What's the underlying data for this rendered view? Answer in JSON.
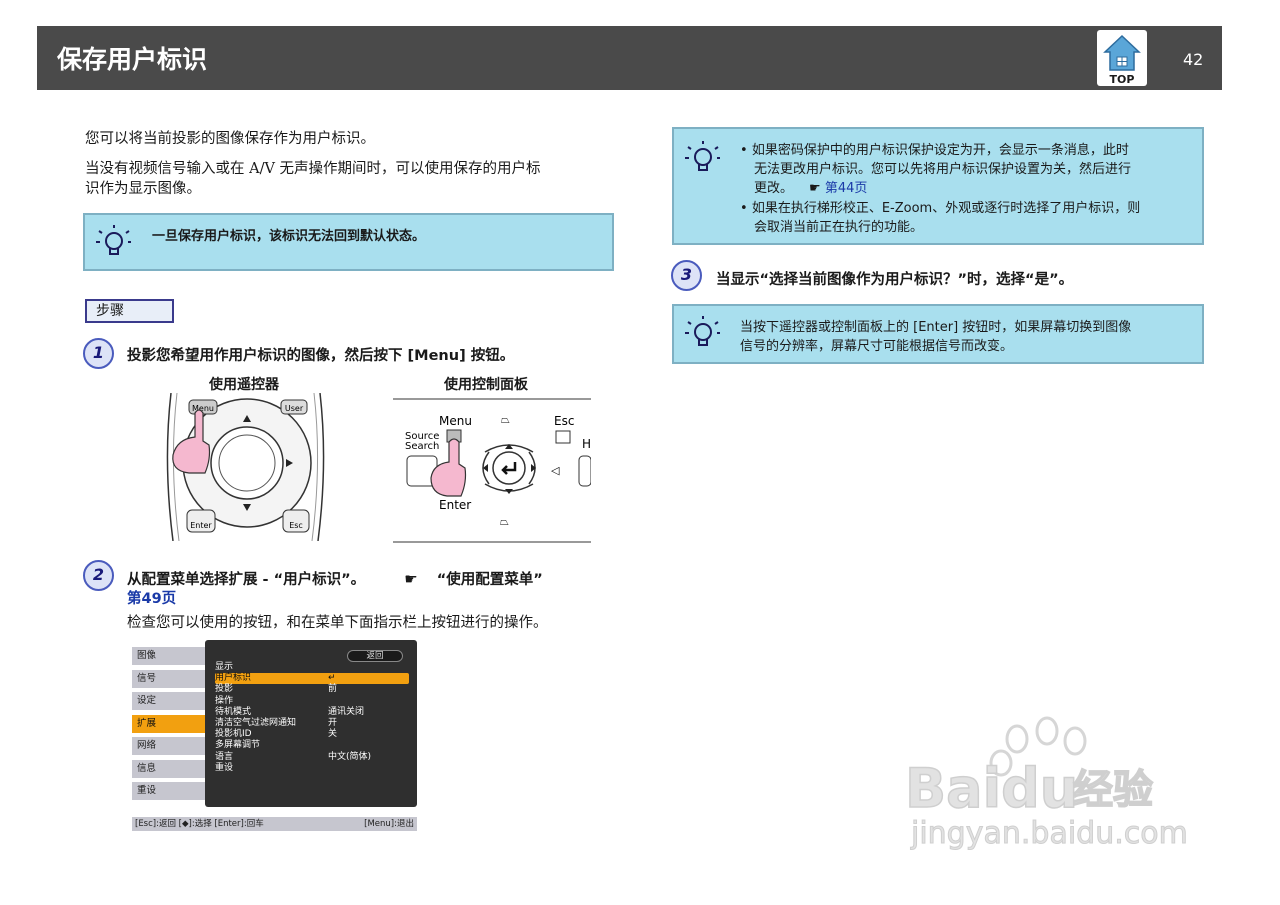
{
  "header": {
    "title": "保存用户标识",
    "top_label": "TOP",
    "page_number": "42"
  },
  "intro": {
    "line1": "您可以将当前投影的图像保存作为用户标识。",
    "line2a": "当没有视频信号输入或在 A/V 无声操作期间时，可以使用保存的用户标",
    "line2b": "识作为显示图像。"
  },
  "note1": {
    "text": "一旦保存用户标识，该标识无法回到默认状态。"
  },
  "steps_label": "步骤",
  "step1": {
    "number": "1",
    "title": "投影您希望用作用户标识的图像，然后按下 [Menu] 按钮。",
    "caption_remote": "使用遥控器",
    "caption_panel": "使用控制面板",
    "remote_labels": {
      "menu": "Menu",
      "user": "User",
      "enter": "Enter",
      "esc": "Esc"
    },
    "panel_labels": {
      "menu": "Menu",
      "esc": "Esc",
      "source": "Source",
      "search": "Search",
      "enter": "Enter",
      "h": "H"
    }
  },
  "step2": {
    "number": "2",
    "title_part1": "从配置菜单选择扩展 - “用户标识”。",
    "ref_icon": "pointing-hand-icon",
    "title_part2": "“使用配置菜单”",
    "page_ref": "第49页",
    "desc": "检查您可以使用的按钮，和在菜单下面指示栏上按钮进行的操作。"
  },
  "menu_screen": {
    "side_items": [
      "图像",
      "信号",
      "设定",
      "扩展",
      "网络",
      "信息",
      "重设"
    ],
    "active_side": "扩展",
    "back_label": "返回",
    "rows": [
      {
        "label": "显示",
        "value": ""
      },
      {
        "label": "用户标识",
        "value": "↵"
      },
      {
        "label": "投影",
        "value": "前"
      },
      {
        "label": "操作",
        "value": ""
      },
      {
        "label": "待机模式",
        "value": "通讯关闭"
      },
      {
        "label": "清洁空气过滤网通知",
        "value": "开"
      },
      {
        "label": "投影机ID",
        "value": "关"
      },
      {
        "label": "多屏幕调节",
        "value": ""
      },
      {
        "label": "语言",
        "value": "中文(简体)"
      },
      {
        "label": "重设",
        "value": ""
      }
    ],
    "selected_row": "用户标识",
    "footer_left": "[Esc]:返回 [◆]:选择 [Enter]:回车",
    "footer_right": "[Menu]:退出"
  },
  "note2": {
    "bullet1_line1": "如果密码保护中的用户标识保护设定为开，会显示一条消息，此时",
    "bullet1_line2": "无法更改用户标识。您可以先将用户标识保护设置为关，然后进行",
    "bullet1_line3": "更改。",
    "bullet1_ref": "第44页",
    "bullet2_line1": "如果在执行梯形校正、E-Zoom、外观或逐行时选择了用户标识，则",
    "bullet2_line2": "会取消当前正在执行的功能。"
  },
  "step3": {
    "number": "3",
    "title": "当显示“选择当前图像作为用户标识？”时，选择“是”。"
  },
  "note3": {
    "line1": "当按下遥控器或控制面板上的 [Enter] 按钮时，如果屏幕切换到图像",
    "line2": "信号的分辨率，屏幕尺寸可能根据信号而改变。"
  },
  "watermark": {
    "brand": "Baidu",
    "sub": "经验",
    "url": "jingyan.baidu.com"
  },
  "colors": {
    "header_bg": "#4a4a4a",
    "note_bg": "#a9dfee",
    "link": "#1a3aa8",
    "menu_highlight": "#f2a010"
  }
}
